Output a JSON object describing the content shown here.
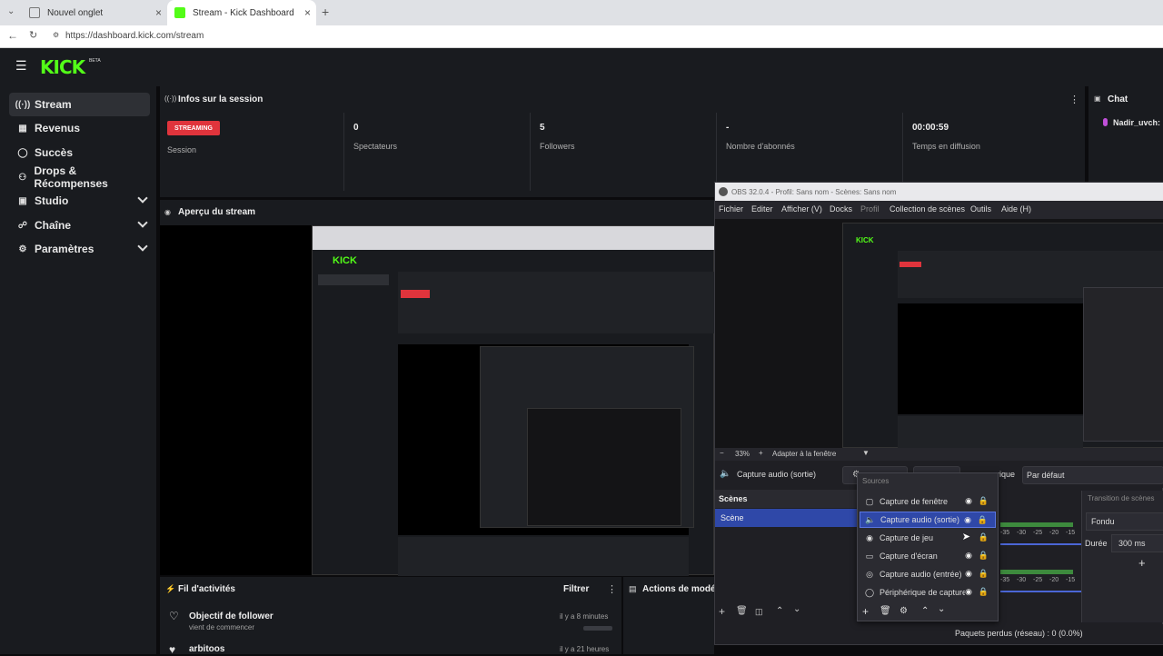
{
  "browser": {
    "tabs": [
      {
        "label": "Nouvel onglet"
      },
      {
        "label": "Stream - Kick Dashboard"
      }
    ],
    "url": "https://dashboard.kick.com/stream"
  },
  "header": {
    "logo": "KICK",
    "beta": "BETA"
  },
  "sidebar": {
    "items": [
      {
        "label": "Stream",
        "icon": "broadcast-icon"
      },
      {
        "label": "Revenus",
        "icon": "revenue-icon"
      },
      {
        "label": "Succès",
        "icon": "trophy-icon"
      },
      {
        "label": "Drops & Récompenses",
        "icon": "drops-icon"
      },
      {
        "label": "Studio",
        "icon": "studio-icon"
      },
      {
        "label": "Chaîne",
        "icon": "channel-icon"
      },
      {
        "label": "Paramètres",
        "icon": "gear-icon"
      }
    ]
  },
  "session": {
    "title": "Infos sur la session",
    "badge": "STREAMING",
    "stats": [
      {
        "value": "",
        "label": "Session"
      },
      {
        "value": "0",
        "label": "Spectateurs"
      },
      {
        "value": "5",
        "label": "Followers"
      },
      {
        "value": "-",
        "label": "Nombre d'abonnés"
      },
      {
        "value": "00:00:59",
        "label": "Temps en diffusion"
      }
    ]
  },
  "preview": {
    "title": "Aperçu du stream"
  },
  "chat": {
    "title": "Chat",
    "user": "Nadir_uvch:"
  },
  "activity": {
    "title": "Fil d'activités",
    "filter": "Filtrer",
    "items": [
      {
        "title": "Objectif de follower",
        "sub": "vient de commencer",
        "time": "il y a 8 minutes"
      },
      {
        "title": "arbitoos",
        "sub": "",
        "time": "il y a 21 heures"
      }
    ]
  },
  "actions": {
    "title": "Actions de modé"
  },
  "obs": {
    "title": "OBS 32.0.4 - Profil: Sans nom - Scènes: Sans nom",
    "menu": [
      "Fichier",
      "Editer",
      "Afficher (V)",
      "Docks",
      "Profil",
      "Collection de scènes",
      "Outils",
      "Aide (H)"
    ],
    "zoom": "33%",
    "fit": "Adapter à la fenêtre",
    "audio_label": "Capture audio (sortie)",
    "mode_suffix": "rique",
    "mode_value": "Par défaut",
    "scenes_title": "Scènes",
    "scene_item": "Scène",
    "sources_title": "Sources",
    "sources": [
      {
        "label": "Capture de fenêtre",
        "icon": "window-icon"
      },
      {
        "label": "Capture audio (sortie)",
        "icon": "speaker-icon"
      },
      {
        "label": "Capture de jeu",
        "icon": "gamepad-icon"
      },
      {
        "label": "Capture d'écran",
        "icon": "monitor-icon"
      },
      {
        "label": "Capture audio (entrée)",
        "icon": "microphone-icon"
      },
      {
        "label": "Périphérique de capture",
        "icon": "camera-icon"
      }
    ],
    "meter_ticks": [
      "-35",
      "-30",
      "-25",
      "-20",
      "-15"
    ],
    "transitions_title": "Transition de scènes",
    "transition_value": "Fondu",
    "duration_label": "Durée",
    "duration_value": "300 ms",
    "status": "Paquets perdus (réseau) : 0 (0.0%)"
  }
}
